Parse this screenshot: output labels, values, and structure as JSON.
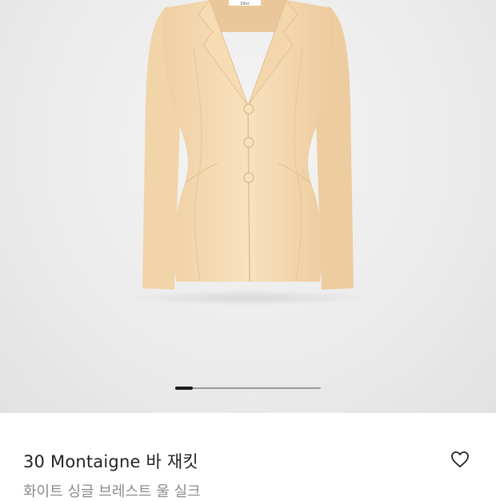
{
  "product": {
    "title": "30 Montaigne 바 재킷",
    "subtitle": "화이트 싱글 브레스트 울 실크"
  },
  "gallery": {
    "image": "cream-single-breasted-jacket",
    "label_text": "Dior",
    "image_progress": 0.12
  },
  "icons": {
    "wishlist": "heart-outline-icon"
  },
  "colors": {
    "jacket": "#f7ddb6",
    "indicator_active": "#1c1c1c",
    "indicator_track": "#9a9a9a",
    "title": "#222222",
    "subtitle": "#8a8a8a"
  }
}
